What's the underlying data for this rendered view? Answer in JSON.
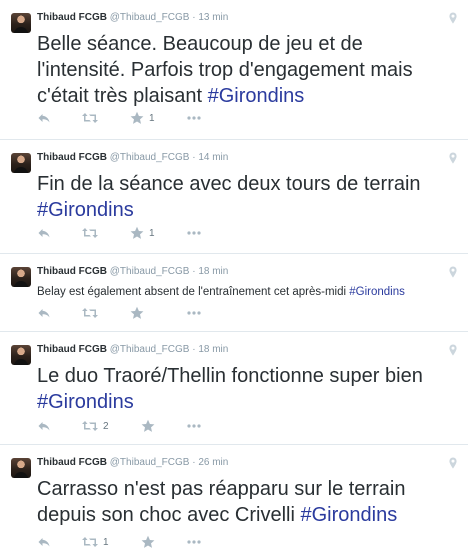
{
  "tweets": [
    {
      "name": "Thibaud FCGB",
      "handle": "@Thibaud_FCGB",
      "dot": "·",
      "time": "13 min",
      "text": "Belle séance. Beaucoup de jeu et de l'intensité. Parfois trop d'engagement mais c'était très plaisant",
      "hashtag": "#Girondins",
      "retweet_count": "",
      "favorite_count": "1"
    },
    {
      "name": "Thibaud FCGB",
      "handle": "@Thibaud_FCGB",
      "dot": "·",
      "time": "14 min",
      "text": "Fin de la séance avec deux tours de terrain",
      "hashtag": "#Girondins",
      "retweet_count": "",
      "favorite_count": "1"
    },
    {
      "name": "Thibaud FCGB",
      "handle": "@Thibaud_FCGB",
      "dot": "·",
      "time": "18 min",
      "text": "Belay est également absent de l'entraînement cet après-midi",
      "hashtag": "#Girondins",
      "retweet_count": "",
      "favorite_count": ""
    },
    {
      "name": "Thibaud FCGB",
      "handle": "@Thibaud_FCGB",
      "dot": "·",
      "time": "18 min",
      "text": "Le duo Traoré/Thellin fonctionne super bien",
      "hashtag": "#Girondins",
      "retweet_count": "2",
      "favorite_count": ""
    },
    {
      "name": "Thibaud FCGB",
      "handle": "@Thibaud_FCGB",
      "dot": "·",
      "time": "26 min",
      "text": "Carrasso n'est pas réapparu sur le terrain depuis son choc avec Crivelli",
      "hashtag": "#Girondins",
      "retweet_count": "1",
      "favorite_count": ""
    }
  ],
  "icons": {
    "reply": "reply-icon",
    "retweet": "retweet-icon",
    "favorite": "star-icon",
    "more": "more-icon",
    "geo": "location-pin-icon"
  },
  "colors": {
    "hashtag": "#2b3b9e",
    "meta": "#8899a6",
    "icon": "#aab8c2",
    "divider": "#e1e8ed"
  }
}
